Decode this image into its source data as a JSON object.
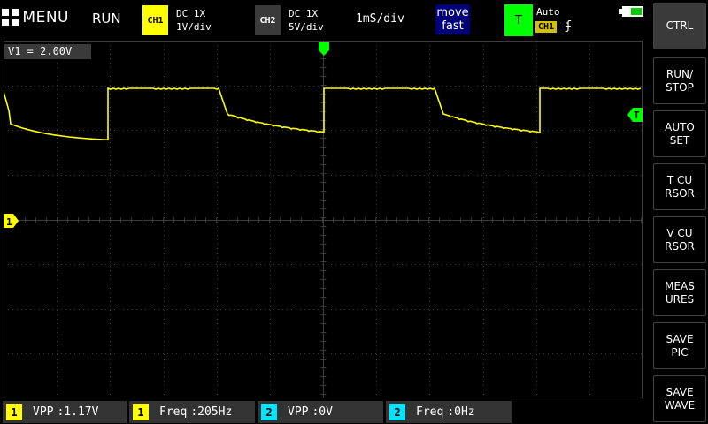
{
  "topbar": {
    "menu_label": "MENU",
    "run_state": "RUN",
    "ch1": {
      "tag": "CH1",
      "coupling": "DC  1X",
      "scale": "1V/div",
      "color": "#ffff00"
    },
    "ch2": {
      "tag": "CH2",
      "coupling": "DC  1X",
      "scale": "5V/div",
      "color": "#3a3a3a"
    },
    "timebase": "1mS/div",
    "move_label_1": "move",
    "move_label_2": "fast",
    "trigger": {
      "tag": "T",
      "mode": "Auto",
      "source": "CH1",
      "edge": "ʄ",
      "color": "#00ff00"
    },
    "battery_icon": "battery-icon"
  },
  "display": {
    "v1_readout": "V1 = 2.00V",
    "ch1_marker": "1",
    "trigger_marker": "T",
    "trace_color": "#ffff00",
    "grid_color": "#3c3c3c"
  },
  "measurements": [
    {
      "channel": "1",
      "label": "VPP",
      "value": ":1.17V",
      "color": "#ffff00"
    },
    {
      "channel": "1",
      "label": "Freq",
      "value": ":205Hz",
      "color": "#ffff00"
    },
    {
      "channel": "2",
      "label": "VPP",
      "value": ":0V",
      "color": "#00e5ff"
    },
    {
      "channel": "2",
      "label": "Freq",
      "value": ":0Hz",
      "color": "#00e5ff"
    }
  ],
  "sidebar": {
    "buttons": [
      {
        "label": "CTRL"
      },
      {
        "label": "RUN/\nSTOP"
      },
      {
        "label": "AUTO\nSET"
      },
      {
        "label": "T CU\nRSOR"
      },
      {
        "label": "V CU\nRSOR"
      },
      {
        "label": "MEAS\nURES"
      },
      {
        "label": "SAVE\nPIC"
      },
      {
        "label": "SAVE\nWAVE"
      }
    ]
  }
}
